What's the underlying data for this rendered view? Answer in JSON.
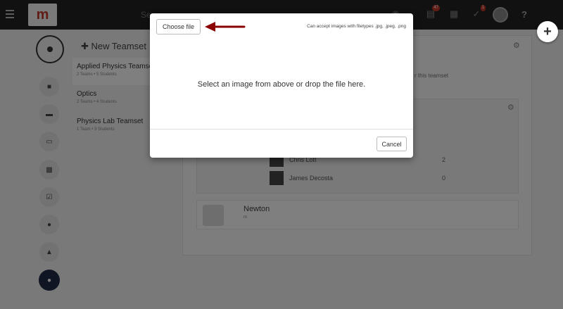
{
  "colors": {
    "accent_red": "#c0392b",
    "topbar": "#222222",
    "arrow": "#8b0000"
  },
  "topbar": {
    "menu_icon": "hamburger-icon",
    "logo_text": "m",
    "search_stub": "Se",
    "icons": [
      "bell-icon",
      "clipboard-icon",
      "calendar-icon",
      "check-badge-icon"
    ],
    "help_label": "?"
  },
  "fab": {
    "label": "+"
  },
  "rail": {
    "icons": [
      "chat-icon",
      "folder-icon",
      "book-icon",
      "chart-icon",
      "checkbox-icon",
      "user-icon",
      "trophy-icon",
      "group-icon"
    ]
  },
  "teamsets": {
    "new_label": "✚ New Teamset",
    "items": [
      {
        "name": "Applied Physics Teamset",
        "sub": "2 Teams • 5 Students"
      },
      {
        "name": "Optics",
        "sub": "2 Teams • 4 Students"
      },
      {
        "name": "Physics Lab Teamset",
        "sub": "1 Team • 3 Students"
      }
    ]
  },
  "main": {
    "drop_hint": "r this teamset",
    "students": [
      {
        "name": "Chris Lott",
        "count": "2"
      },
      {
        "name": "James Decosta",
        "count": "0"
      }
    ],
    "newton": {
      "name": "Newton",
      "sub": "m"
    }
  },
  "modal": {
    "choose_label": "Choose file",
    "accept_text": "Can accept images with filetypes .jpg, .jpeg, .png",
    "drop_text": "Select an image from above or drop the file here.",
    "cancel_label": "Cancel"
  }
}
